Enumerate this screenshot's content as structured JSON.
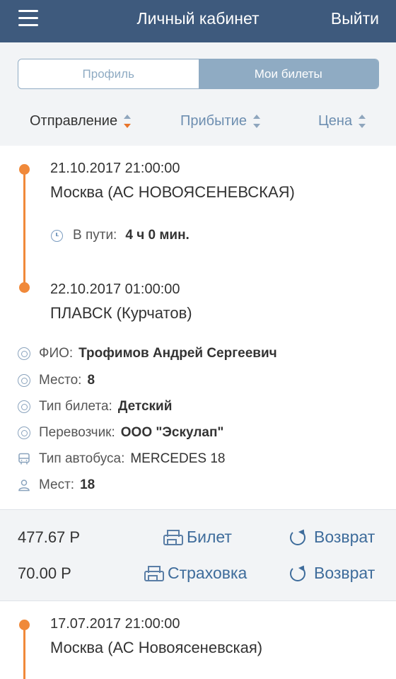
{
  "header": {
    "title": "Личный кабинет",
    "logout": "Выйти",
    "menu_icon": "hamburger-menu-icon",
    "background": "#3e5a7d"
  },
  "tabs": {
    "profile": "Профиль",
    "tickets": "Мои билеты",
    "active": "tickets"
  },
  "sort": {
    "departure": "Отправление",
    "arrival": "Прибытие",
    "price": "Цена",
    "active": "departure",
    "accent_color": "#e8752a"
  },
  "ticket1": {
    "departure_datetime": "21.10.2017 21:00:00",
    "departure_station": "Москва (АС НОВОЯСЕНЕВСКАЯ)",
    "travel_label": "В пути:",
    "travel_time": "4 ч 0 мин.",
    "arrival_datetime": "22.10.2017 01:00:00",
    "arrival_station": "ПЛАВСК (Курчатов)",
    "details": [
      {
        "icon": "steering-wheel-icon",
        "label": "ФИО:",
        "value": "Трофимов Андрей Сергеевич"
      },
      {
        "icon": "steering-wheel-icon",
        "label": "Место:",
        "value": "8"
      },
      {
        "icon": "steering-wheel-icon",
        "label": "Тип билета:",
        "value": "Детский"
      },
      {
        "icon": "steering-wheel-icon",
        "label": "Перевозчик:",
        "value": "ООО \"Эскулап\""
      },
      {
        "icon": "bus-icon",
        "label": "Тип автобуса:",
        "value": "MERCEDES 18"
      },
      {
        "icon": "person-icon",
        "label": "Мест:",
        "value": "18"
      }
    ],
    "payments": [
      {
        "amount": "477.67 Р",
        "doc_label": "Билет",
        "refund_label": "Возврат"
      },
      {
        "amount": "70.00 Р",
        "doc_label": "Страховка",
        "refund_label": "Возврат"
      }
    ]
  },
  "ticket2": {
    "departure_datetime": "17.07.2017 21:00:00",
    "departure_station": "Москва (АС Новоясеневская)"
  },
  "colors": {
    "timeline": "#f0893a",
    "link": "#3e6c9b",
    "tab_active": "#8fabc3"
  }
}
